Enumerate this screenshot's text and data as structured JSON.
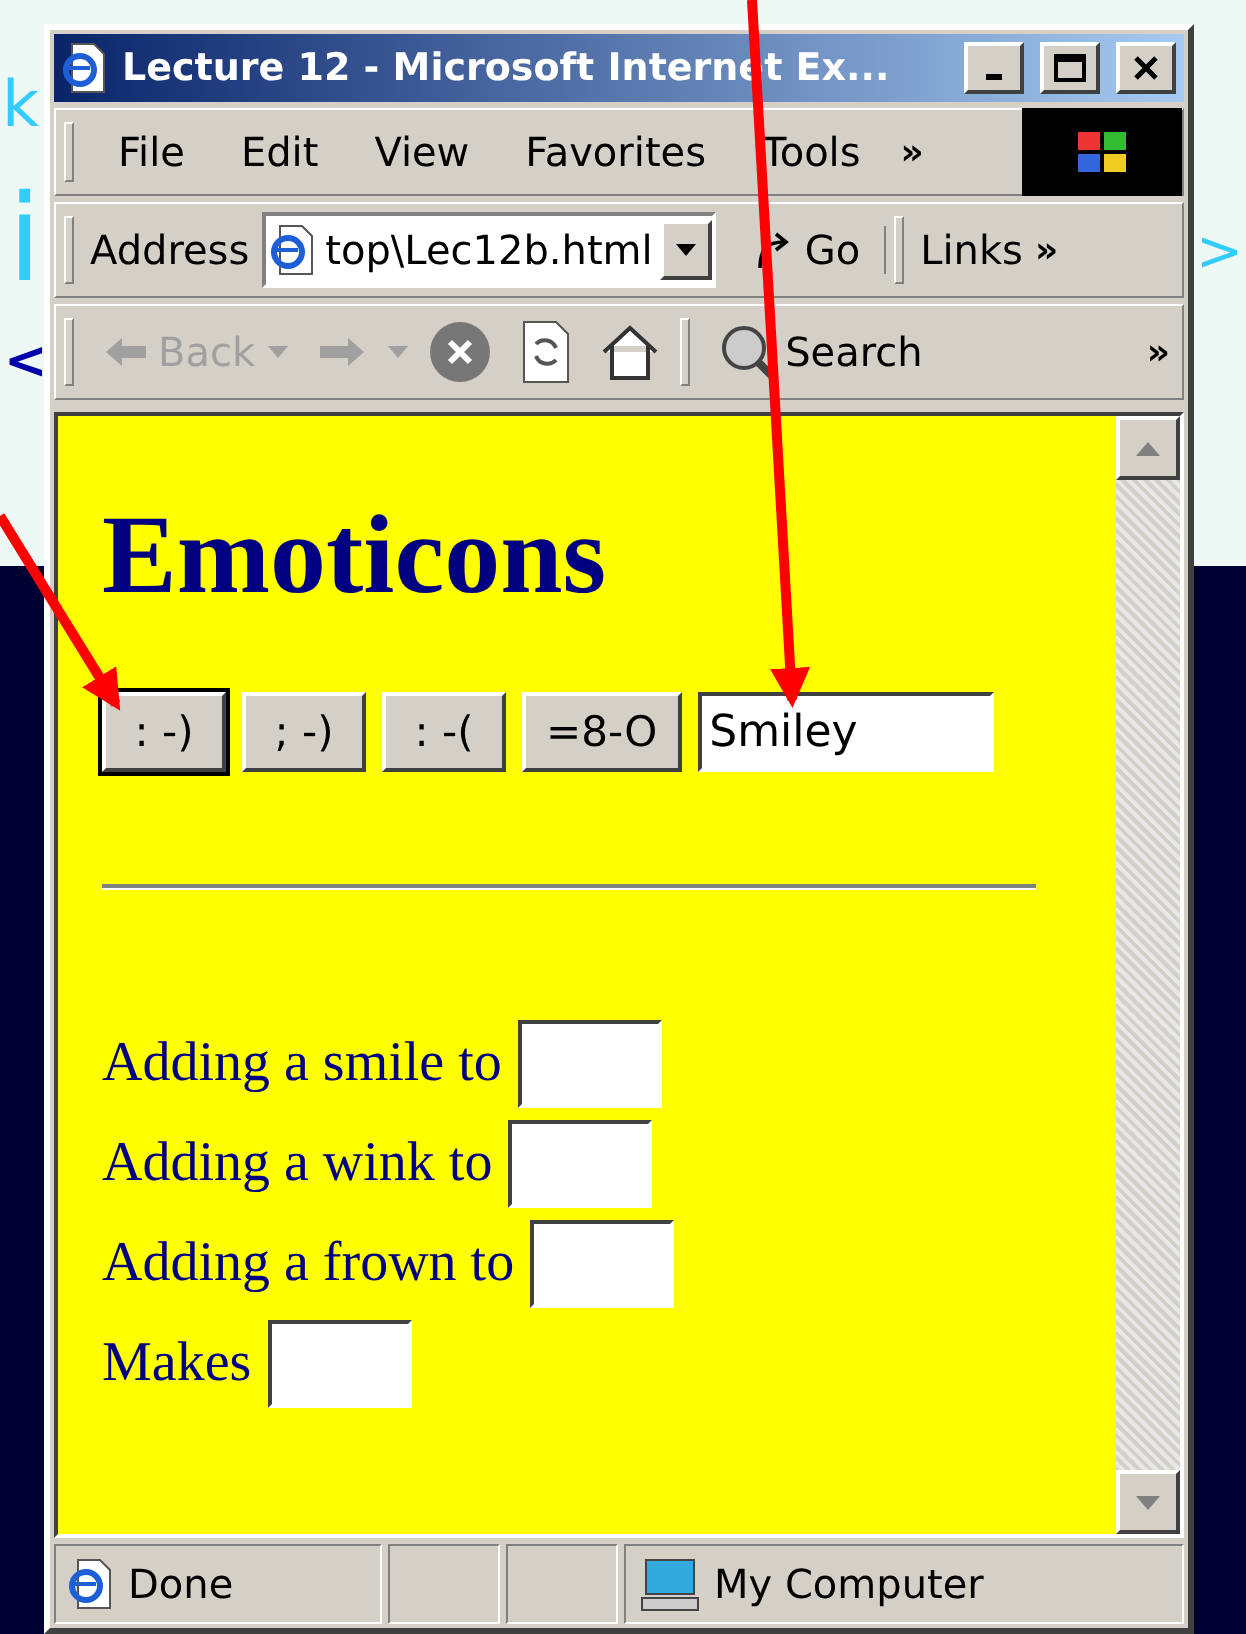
{
  "slide": {
    "fragments": [
      {
        "text": "k",
        "kind": "big"
      },
      {
        "text": "i",
        "kind": "big"
      },
      {
        "text": ">",
        "kind": "big"
      },
      {
        "text": "<",
        "kind": "small"
      }
    ]
  },
  "window": {
    "title": "Lecture 12 - Microsoft Internet Ex...",
    "menu": [
      "File",
      "Edit",
      "View",
      "Favorites",
      "Tools"
    ],
    "menu_more": "»",
    "address": {
      "label": "Address",
      "value": "top\\Lec12b.html",
      "go": "Go",
      "links": "Links",
      "more": "»"
    },
    "toolbar": {
      "back": "Back",
      "search": "Search",
      "more": "»"
    },
    "page": {
      "heading": "Emoticons",
      "buttons": [
        {
          "label": ": -)",
          "focused": true
        },
        {
          "label": "; -)",
          "focused": false
        },
        {
          "label": ": -(",
          "focused": false
        },
        {
          "label": "=8-O",
          "focused": false
        }
      ],
      "name_field": {
        "value": "Smiley"
      },
      "rows": [
        {
          "label": "Adding a smile to"
        },
        {
          "label": "Adding a wink to"
        },
        {
          "label": "Adding a frown to"
        },
        {
          "label": "Makes"
        }
      ]
    },
    "status_bar": {
      "text": "Done",
      "zone": "My Computer"
    }
  }
}
